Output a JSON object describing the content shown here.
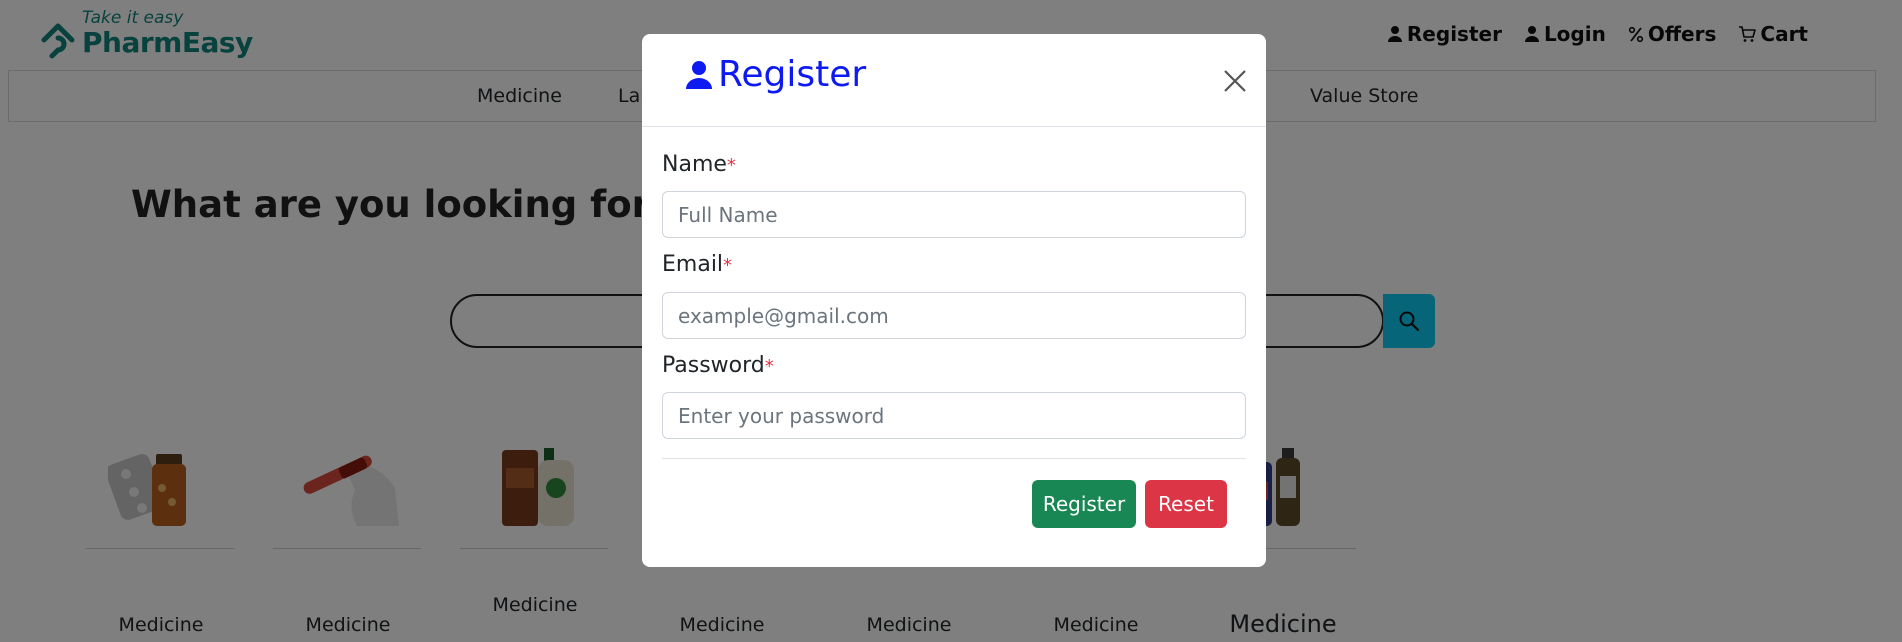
{
  "header": {
    "logo_tagline": "Take it easy",
    "logo_name": "PharmEasy",
    "links": [
      {
        "label": "Register",
        "icon": "person-icon"
      },
      {
        "label": "Login",
        "icon": "person-icon"
      },
      {
        "label": "Offers",
        "icon": "percent-icon"
      },
      {
        "label": "Cart",
        "icon": "cart-icon"
      }
    ]
  },
  "nav": {
    "items": [
      "Medicine",
      "Lab",
      "Value Store"
    ]
  },
  "main": {
    "hero_title": "What are you looking for?",
    "categories": [
      {
        "label": "Medicine"
      },
      {
        "label": "Medicine"
      },
      {
        "label": "Medicine"
      },
      {
        "label": "Medicine"
      },
      {
        "label": "Medicine"
      },
      {
        "label": "Medicine"
      },
      {
        "label": "Medicine"
      }
    ]
  },
  "modal": {
    "title": "Register",
    "fields": {
      "name": {
        "label": "Name",
        "required_mark": "*",
        "placeholder": "Full Name",
        "value": ""
      },
      "email": {
        "label": "Email",
        "required_mark": "*",
        "placeholder": "example@gmail.com",
        "value": ""
      },
      "password": {
        "label": "Password",
        "required_mark": "*",
        "placeholder": "Enter your password",
        "value": ""
      }
    },
    "register_button": "Register",
    "reset_button": "Reset"
  },
  "colors": {
    "brand": "#10847e",
    "modal_title": "#0d1bf2",
    "register": "#198754",
    "reset": "#dc3545",
    "search_button": "#0dcaf0"
  }
}
